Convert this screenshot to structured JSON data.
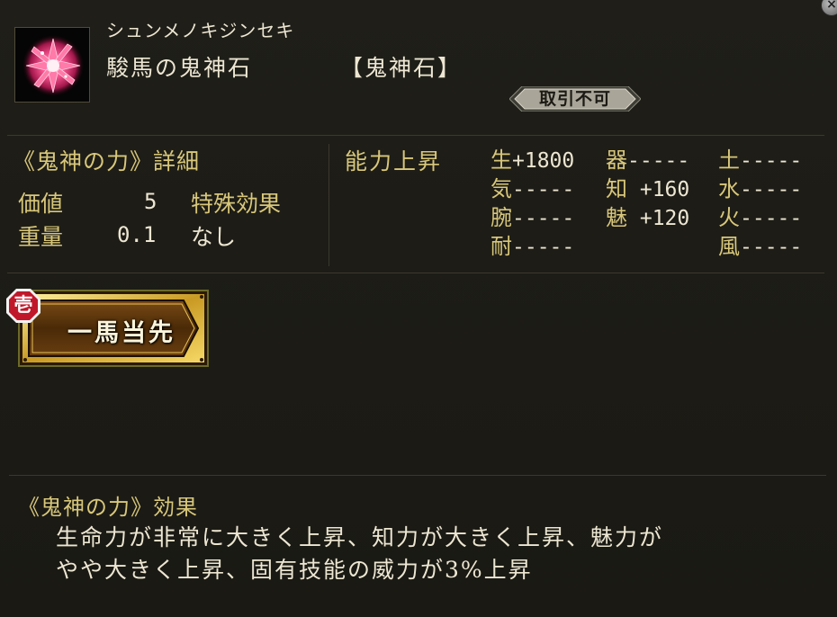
{
  "item": {
    "reading": "シュンメノキジンセキ",
    "name": "駿馬の鬼神石",
    "category": "【鬼神石】",
    "trade_status": "取引不可"
  },
  "details": {
    "title": "《鬼神の力》詳細",
    "value_label": "価値",
    "value": "5",
    "weight_label": "重量",
    "weight": "0.1",
    "special_label": "特殊効果",
    "special_value": "なし"
  },
  "ability": {
    "title": "能力上昇",
    "stats": [
      {
        "key": "生",
        "value": "+1800"
      },
      {
        "key": "器",
        "value": "-----"
      },
      {
        "key": "土",
        "value": "-----"
      },
      {
        "key": "気",
        "value": "-----"
      },
      {
        "key": "知",
        "value": " +160"
      },
      {
        "key": "水",
        "value": "-----"
      },
      {
        "key": "腕",
        "value": "-----"
      },
      {
        "key": "魅",
        "value": " +120"
      },
      {
        "key": "火",
        "value": "-----"
      },
      {
        "key": "耐",
        "value": "-----"
      },
      {
        "key": "風",
        "value": "-----"
      }
    ]
  },
  "skill": {
    "rank": "壱",
    "name": "一馬当先"
  },
  "effect": {
    "title": "《鬼神の力》効果",
    "lines": [
      "生命力が非常に大きく上昇、知力が大きく上昇、魅力が",
      "やや大きく上昇、固有技能の威力が3%上昇"
    ]
  },
  "colors": {
    "background": "#1c1b16",
    "label_gold": "#d8c77a",
    "text": "#ece6d2",
    "gem_pink": "#e0407a",
    "rank_red": "#c0182a"
  },
  "icons": {
    "close": "close-icon",
    "item": "crystal-gem-icon",
    "rank": "rank-seal-icon"
  }
}
